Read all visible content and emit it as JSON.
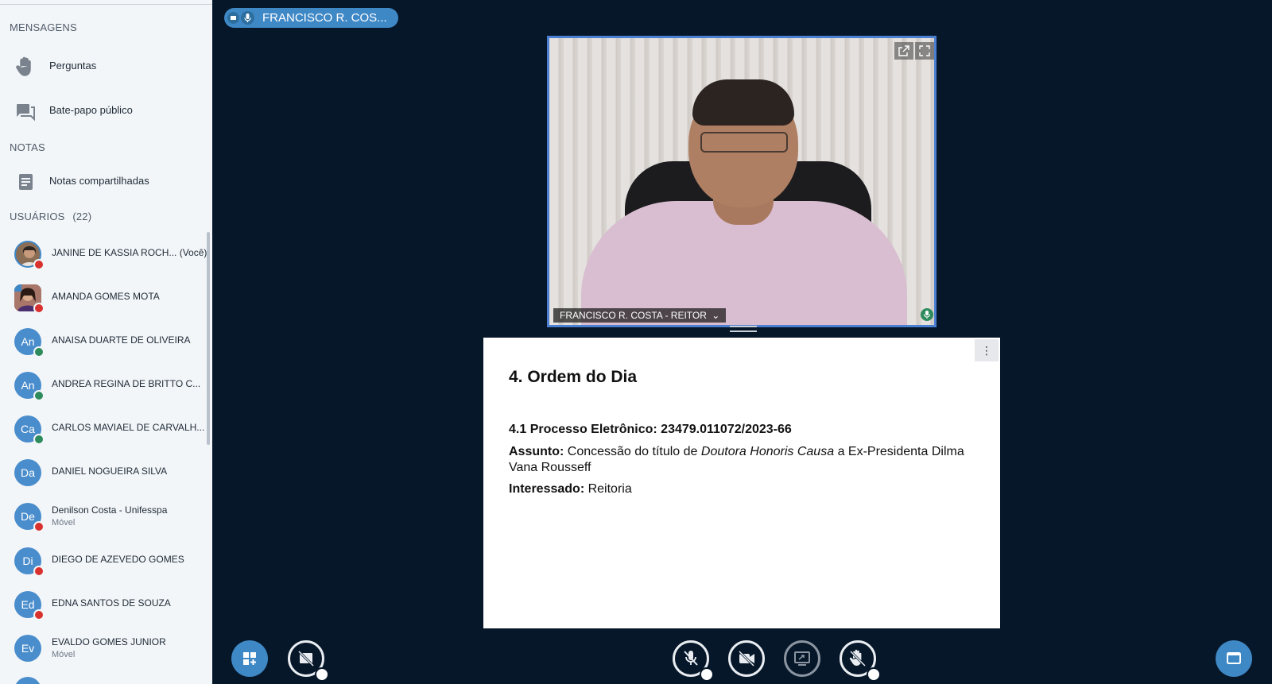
{
  "sidebar": {
    "messages_title": "MENSAGENS",
    "questions_label": "Perguntas",
    "public_chat_label": "Bate-papo público",
    "notes_title": "NOTAS",
    "shared_notes_label": "Notas compartilhadas",
    "users_title": "USUÁRIOS",
    "users_count": "(22)",
    "users": [
      {
        "initials": "",
        "name": "JANINE DE KASSIA ROCH... (Você)",
        "sub": "",
        "status": "muted"
      },
      {
        "initials": "",
        "name": "AMANDA GOMES MOTA",
        "sub": "",
        "status": "muted"
      },
      {
        "initials": "An",
        "name": "ANAISA DUARTE DE OLIVEIRA",
        "sub": "",
        "status": "listen"
      },
      {
        "initials": "An",
        "name": "ANDREA REGINA DE BRITTO C...",
        "sub": "",
        "status": "listen"
      },
      {
        "initials": "Ca",
        "name": "CARLOS MAVIAEL DE CARVALH...",
        "sub": "",
        "status": "listen"
      },
      {
        "initials": "Da",
        "name": "DANIEL NOGUEIRA SILVA",
        "sub": "",
        "status": "none"
      },
      {
        "initials": "De",
        "name": "Denilson Costa - Unifesspa",
        "sub": "Móvel",
        "status": "muted"
      },
      {
        "initials": "Di",
        "name": "DIEGO DE AZEVEDO GOMES",
        "sub": "",
        "status": "muted"
      },
      {
        "initials": "Ed",
        "name": "EDNA SANTOS DE SOUZA",
        "sub": "",
        "status": "muted"
      },
      {
        "initials": "Ev",
        "name": "EVALDO GOMES JUNIOR",
        "sub": "Móvel",
        "status": "none"
      }
    ]
  },
  "presenter_pill": "FRANCISCO R. COS...",
  "video": {
    "label": "FRANCISCO R. COSTA - REITOR",
    "label_caret": "⌄"
  },
  "slide": {
    "heading": "4. Ordem do Dia",
    "process": "4.1 Processo Eletrônico: 23479.011072/2023-66",
    "subject_label": "Assunto:",
    "subject_text_1": "Concessão do título de",
    "subject_italic": "Doutora Honoris Causa",
    "subject_text_2": "a Ex-Presidenta Dilma Vana Rousseff",
    "interested_label": "Interessado:",
    "interested_value": "Reitoria",
    "menu_icon": "⋮"
  },
  "colors": {
    "background": "#06172a",
    "sidebar": "#f3f6f9",
    "accent": "#3f88c6",
    "muted_status": "#d8312e",
    "listen_status": "#2e8b5d"
  }
}
